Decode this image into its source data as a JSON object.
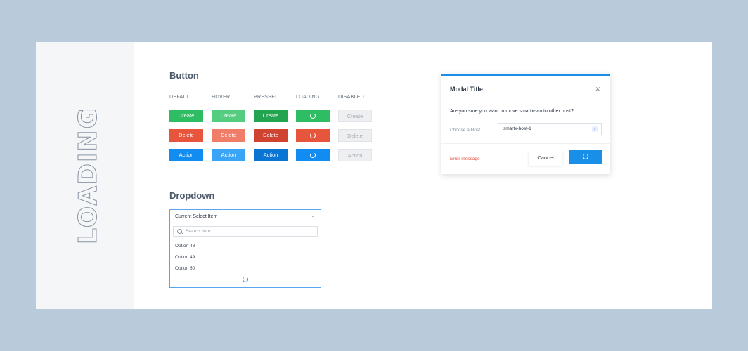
{
  "sidebar": {
    "vertical_label": "LOADING"
  },
  "button_section": {
    "title": "Button",
    "columns": [
      "DEFAULT",
      "HOVER",
      "PRESSED",
      "LOADING",
      "DISABLED"
    ],
    "labels": {
      "create": "Create",
      "delete": "Delete",
      "action": "Action"
    }
  },
  "dropdown_section": {
    "title": "Dropdown",
    "current": "Current Select Item",
    "search_placeholder": "Search Item",
    "options": [
      "Option 48",
      "Option 49",
      "Option 50"
    ]
  },
  "modal": {
    "title": "Modal Title",
    "question": "Are you sure you want to move smartx-vm to other host?",
    "host_label": "Choose a Host",
    "host_value": "smartx-host-1",
    "error": "Error message",
    "cancel": "Cancel"
  },
  "colors": {
    "create": [
      "#2ebd62",
      "#55cd80",
      "#23a451",
      "#2ebd62",
      "#eeeff1"
    ],
    "delete": [
      "#e8553d",
      "#ef7d68",
      "#cf4330",
      "#e8553d",
      "#eeeff1"
    ],
    "action": [
      "#128cf1",
      "#3aa5f7",
      "#0a75d3",
      "#128cf1",
      "#eeeff1"
    ]
  }
}
